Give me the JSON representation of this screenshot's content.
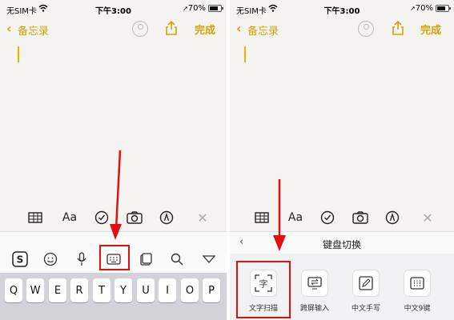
{
  "status_bar": {
    "carrier": "无SIM卡",
    "time": "下午3:00",
    "battery_text": "70%",
    "battery_level": 0.7
  },
  "nav": {
    "back_label": "备忘录",
    "done_label": "完成"
  },
  "format_toolbar": {
    "aa_label": "Aa"
  },
  "keyboard_row": [
    "Q",
    "W",
    "E",
    "R",
    "T",
    "Y",
    "U",
    "I",
    "O",
    "P"
  ],
  "keyboard_switch": {
    "title": "键盘切换",
    "options": [
      {
        "label": "文字扫描",
        "icon": "text-scan-icon",
        "glyph": "字"
      },
      {
        "label": "跨屏输入",
        "icon": "cross-screen-input-icon"
      },
      {
        "label": "中文手写",
        "icon": "handwriting-icon"
      },
      {
        "label": "中文9键",
        "icon": "nine-key-icon"
      }
    ]
  },
  "colors": {
    "accent": "#d4a20a",
    "highlight": "#e01010",
    "paper": "#f4f3ef"
  }
}
